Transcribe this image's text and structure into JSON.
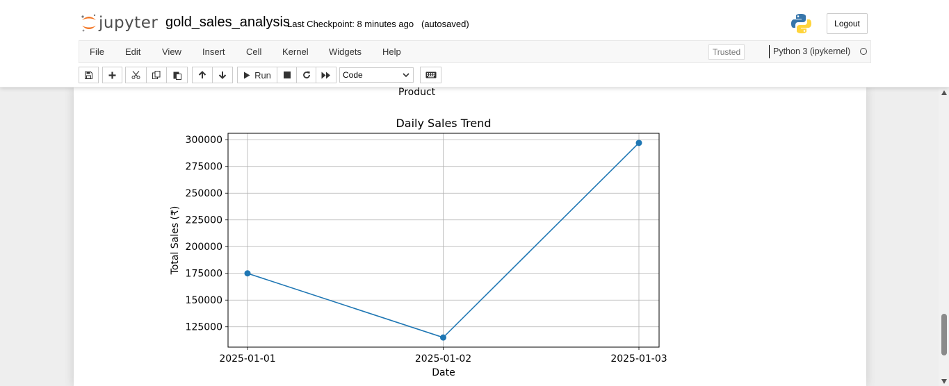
{
  "app": {
    "logo_text": "jupyter",
    "notebook_name": "gold_sales_analysis",
    "checkpoint": "Last Checkpoint: 8 minutes ago",
    "autosave": "(autosaved)",
    "logout_label": "Logout"
  },
  "menu": {
    "items": [
      "File",
      "Edit",
      "View",
      "Insert",
      "Cell",
      "Kernel",
      "Widgets",
      "Help"
    ],
    "trusted": "Trusted",
    "kernel": "Python 3 (ipykernel)"
  },
  "toolbar": {
    "run_label": "Run",
    "cell_type": "Code",
    "icons": [
      "save-icon",
      "plus-icon",
      "cut-icon",
      "copy-icon",
      "paste-icon",
      "arrow-up-icon",
      "arrow-down-icon",
      "run-icon",
      "stop-icon",
      "restart-icon",
      "fast-forward-icon",
      "keyboard-icon"
    ]
  },
  "output": {
    "previous_axis_label": "Product"
  },
  "chart_data": {
    "type": "line",
    "title": "Daily Sales Trend",
    "xlabel": "Date",
    "ylabel": "Total Sales (₹)",
    "categories": [
      "2025-01-01",
      "2025-01-02",
      "2025-01-03"
    ],
    "values": [
      175000,
      115000,
      297000
    ],
    "yticks": [
      125000,
      150000,
      175000,
      200000,
      225000,
      250000,
      275000,
      300000
    ],
    "ytick_labels": [
      "125000",
      "150000",
      "175000",
      "200000",
      "225000",
      "250000",
      "275000",
      "300000"
    ],
    "ylim": [
      106000,
      306000
    ],
    "grid": true,
    "marker": "circle",
    "color": "#1f77b4"
  }
}
